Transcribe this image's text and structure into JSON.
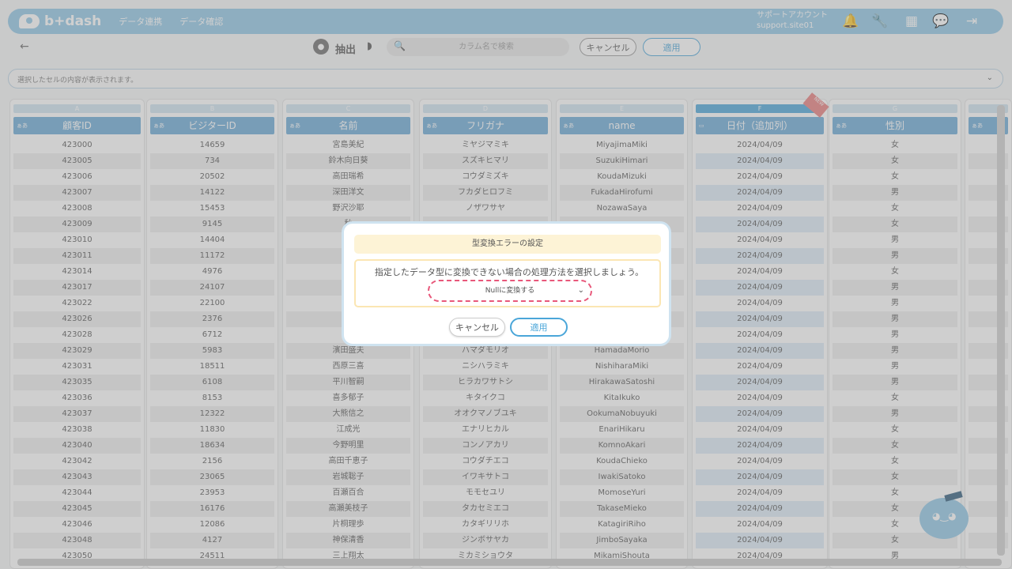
{
  "app": {
    "logo": "b+dash",
    "nav": [
      "データ連携",
      "データ確認"
    ],
    "account": {
      "name": "サポートアカウント",
      "id": "support.site01"
    }
  },
  "toolbar": {
    "extract_label": "抽出",
    "search_placeholder": "カラム名で検索",
    "cancel_label": "キャンセル",
    "apply_label": "適用"
  },
  "cellbar": {
    "text": "選択したセルの内容が表示されます。"
  },
  "icons": [
    "bell-icon",
    "wrench-icon",
    "grid-icon",
    "chat-icon",
    "logout-icon"
  ],
  "grid": {
    "letters": [
      "A",
      "B",
      "C",
      "D",
      "E",
      "F",
      "G",
      ""
    ],
    "headers": [
      "顧客ID",
      "ビジターID",
      "名前",
      "フリガナ",
      "name",
      "日付（追加列）",
      "性別",
      ""
    ],
    "rows": [
      [
        "423000",
        "14659",
        "宮島美紀",
        "ミヤジマミキ",
        "MiyajimaMiki",
        "2024/04/09",
        "女"
      ],
      [
        "423005",
        "734",
        "鈴木向日葵",
        "スズキヒマリ",
        "SuzukiHimari",
        "2024/04/09",
        "女"
      ],
      [
        "423006",
        "20502",
        "高田瑞希",
        "コウダミズキ",
        "KoudaMizuki",
        "2024/04/09",
        "女"
      ],
      [
        "423007",
        "14122",
        "深田洋文",
        "フカダヒロフミ",
        "FukadaHirofumi",
        "2024/04/09",
        "男"
      ],
      [
        "423008",
        "15453",
        "野沢沙耶",
        "ノザワサヤ",
        "NozawaSaya",
        "2024/04/09",
        "女"
      ],
      [
        "423009",
        "9145",
        "秋",
        "",
        "",
        "2024/04/09",
        "女"
      ],
      [
        "423010",
        "14404",
        "芦",
        "",
        "",
        "2024/04/09",
        "男"
      ],
      [
        "423011",
        "11172",
        "二",
        "",
        "",
        "2024/04/09",
        "男"
      ],
      [
        "423014",
        "4976",
        "",
        "",
        "",
        "2024/04/09",
        "女"
      ],
      [
        "423017",
        "24107",
        "五",
        "",
        "",
        "2024/04/09",
        "男"
      ],
      [
        "423022",
        "22100",
        "重",
        "",
        "",
        "2024/04/09",
        "男"
      ],
      [
        "423026",
        "2376",
        "沢",
        "",
        "",
        "2024/04/09",
        "男"
      ],
      [
        "423028",
        "6712",
        "安",
        "",
        "",
        "2024/04/09",
        "男"
      ],
      [
        "423029",
        "5983",
        "濱田盛夫",
        "ハマダモリオ",
        "HamadaMorio",
        "2024/04/09",
        "男"
      ],
      [
        "423031",
        "18511",
        "西原三喜",
        "ニシハラミキ",
        "NishiharaMiki",
        "2024/04/09",
        "男"
      ],
      [
        "423035",
        "6108",
        "平川智嗣",
        "ヒラカワサトシ",
        "HirakawaSatoshi",
        "2024/04/09",
        "男"
      ],
      [
        "423036",
        "8153",
        "喜多郁子",
        "キタイクコ",
        "KitaIkuko",
        "2024/04/09",
        "女"
      ],
      [
        "423037",
        "12322",
        "大熊信之",
        "オオクマノブユキ",
        "OokumaNobuyuki",
        "2024/04/09",
        "男"
      ],
      [
        "423038",
        "11830",
        "江成光",
        "エナリヒカル",
        "EnariHikaru",
        "2024/04/09",
        "女"
      ],
      [
        "423040",
        "18634",
        "今野明里",
        "コンノアカリ",
        "KomnoAkari",
        "2024/04/09",
        "女"
      ],
      [
        "423042",
        "2156",
        "高田千恵子",
        "コウダチエコ",
        "KoudaChieko",
        "2024/04/09",
        "女"
      ],
      [
        "423043",
        "23065",
        "岩城聡子",
        "イワキサトコ",
        "IwakiSatoko",
        "2024/04/09",
        "女"
      ],
      [
        "423044",
        "23953",
        "百瀬百合",
        "モモセユリ",
        "MomoseYuri",
        "2024/04/09",
        "女"
      ],
      [
        "423045",
        "16176",
        "高瀬美枝子",
        "タカセミエコ",
        "TakaseMieko",
        "2024/04/09",
        "女"
      ],
      [
        "423046",
        "12086",
        "片桐理歩",
        "カタギリリホ",
        "KatagiriRiho",
        "2024/04/09",
        "女"
      ],
      [
        "423048",
        "4127",
        "神保清香",
        "ジンボサヤカ",
        "JimboSayaka",
        "2024/04/09",
        "女"
      ],
      [
        "423050",
        "24511",
        "三上翔太",
        "ミカミショウタ",
        "MikamiShouta",
        "2024/04/09",
        "男"
      ]
    ]
  },
  "modal": {
    "title": "型変換エラーの設定",
    "body": "指定したデータ型に変換できない場合の処理方法を選択しましょう。",
    "select_value": "Nullに変換する",
    "cancel_label": "キャンセル",
    "apply_label": "適用"
  },
  "new_badge": "NEW",
  "colors": {
    "accent": "#8fc6e6",
    "header": "#6aa9d6",
    "danger": "#e8577a"
  }
}
